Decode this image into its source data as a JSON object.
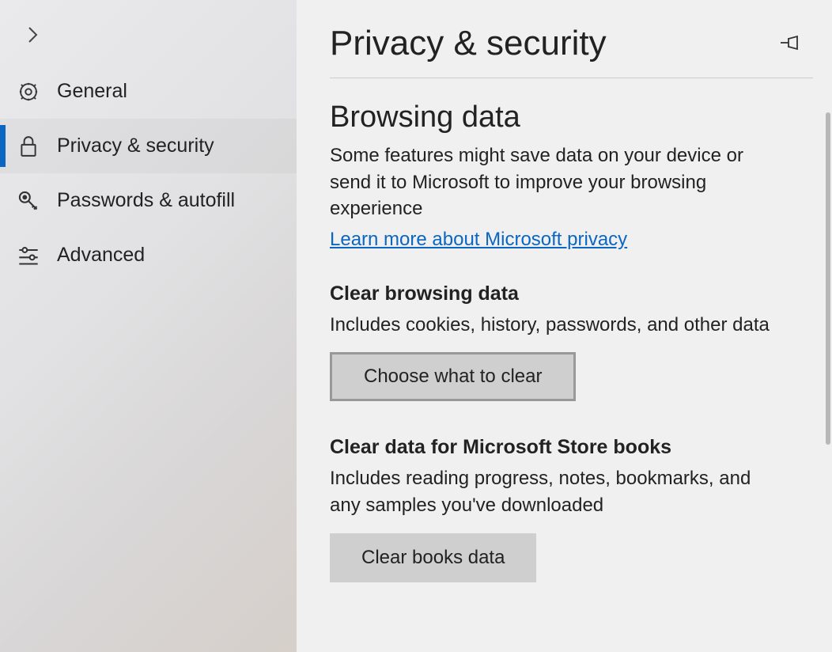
{
  "sidebar": {
    "items": [
      {
        "label": "General",
        "icon": "gear-icon",
        "selected": false
      },
      {
        "label": "Privacy & security",
        "icon": "lock-icon",
        "selected": true
      },
      {
        "label": "Passwords & autofill",
        "icon": "key-icon",
        "selected": false
      },
      {
        "label": "Advanced",
        "icon": "sliders-icon",
        "selected": false
      }
    ]
  },
  "header": {
    "title": "Privacy & security"
  },
  "sections": {
    "browsing_data": {
      "title": "Browsing data",
      "description": "Some features might save data on your device or send it to Microsoft to improve your browsing experience",
      "link_text": "Learn more about Microsoft privacy"
    },
    "clear_browsing": {
      "title": "Clear browsing data",
      "description": "Includes cookies, history, passwords, and other data",
      "button": "Choose what to clear"
    },
    "clear_books": {
      "title": "Clear data for Microsoft Store books",
      "description": "Includes reading progress, notes, bookmarks, and any samples you've downloaded",
      "button": "Clear books data"
    }
  }
}
